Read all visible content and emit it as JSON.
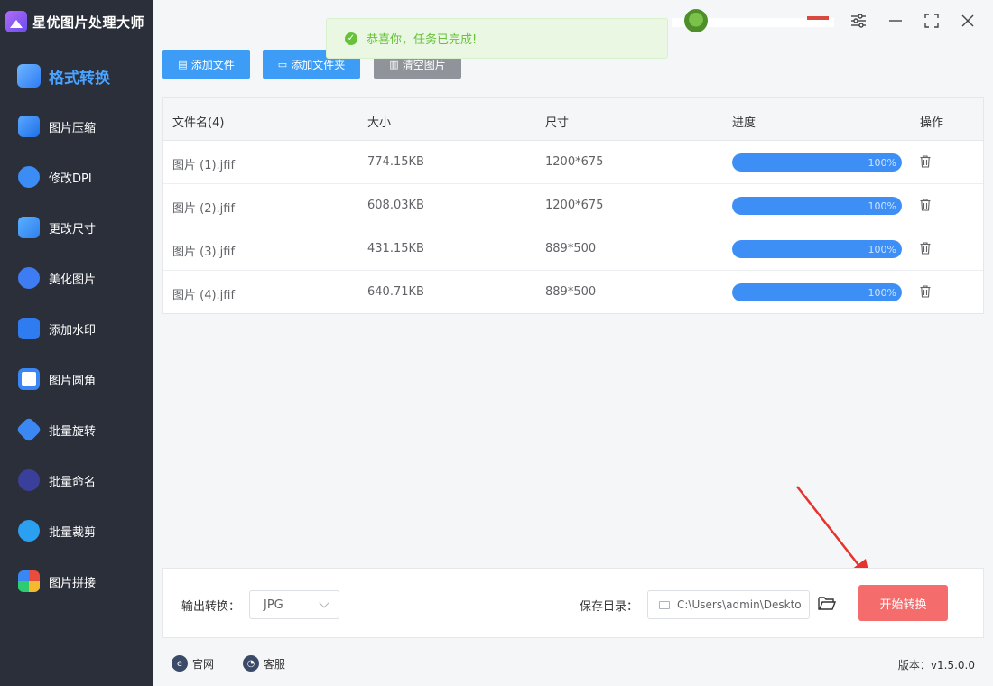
{
  "app": {
    "title": "星优图片处理大师"
  },
  "sidebar": {
    "items": [
      {
        "label": "格式转换",
        "active": true
      },
      {
        "label": "图片压缩"
      },
      {
        "label": "修改DPI"
      },
      {
        "label": "更改尺寸"
      },
      {
        "label": "美化图片"
      },
      {
        "label": "添加水印"
      },
      {
        "label": "图片圆角"
      },
      {
        "label": "批量旋转"
      },
      {
        "label": "批量命名"
      },
      {
        "label": "批量裁剪"
      },
      {
        "label": "图片拼接"
      }
    ]
  },
  "toast": {
    "message": "恭喜你，任务已完成!",
    "color": "#67c23a"
  },
  "toolbar": {
    "add_file": "添加文件",
    "add_folder": "添加文件夹",
    "clear": "清空图片"
  },
  "table": {
    "headers": {
      "name": "文件名(4)",
      "size": "大小",
      "dimensions": "尺寸",
      "progress": "进度",
      "actions": "操作"
    },
    "rows": [
      {
        "name": "图片 (1).jfif",
        "size": "774.15KB",
        "dimensions": "1200*675",
        "progress": 100,
        "progress_label": "100%"
      },
      {
        "name": "图片 (2).jfif",
        "size": "608.03KB",
        "dimensions": "1200*675",
        "progress": 100,
        "progress_label": "100%"
      },
      {
        "name": "图片 (3).jfif",
        "size": "431.15KB",
        "dimensions": "889*500",
        "progress": 100,
        "progress_label": "100%"
      },
      {
        "name": "图片 (4).jfif",
        "size": "640.71KB",
        "dimensions": "889*500",
        "progress": 100,
        "progress_label": "100%"
      }
    ]
  },
  "output": {
    "format_label": "输出转换：",
    "format_value": "JPG",
    "dir_label": "保存目录：",
    "dir_value": "C:\\Users\\admin\\Deskto",
    "start_button": "开始转换"
  },
  "footer": {
    "website": "官网",
    "support": "客服",
    "version": "版本：v1.5.0.0"
  },
  "colors": {
    "accent": "#3d9cf5",
    "start_button": "#f56c6c",
    "sidebar_bg": "#2b2f3a",
    "arrow": "#e8322c"
  }
}
